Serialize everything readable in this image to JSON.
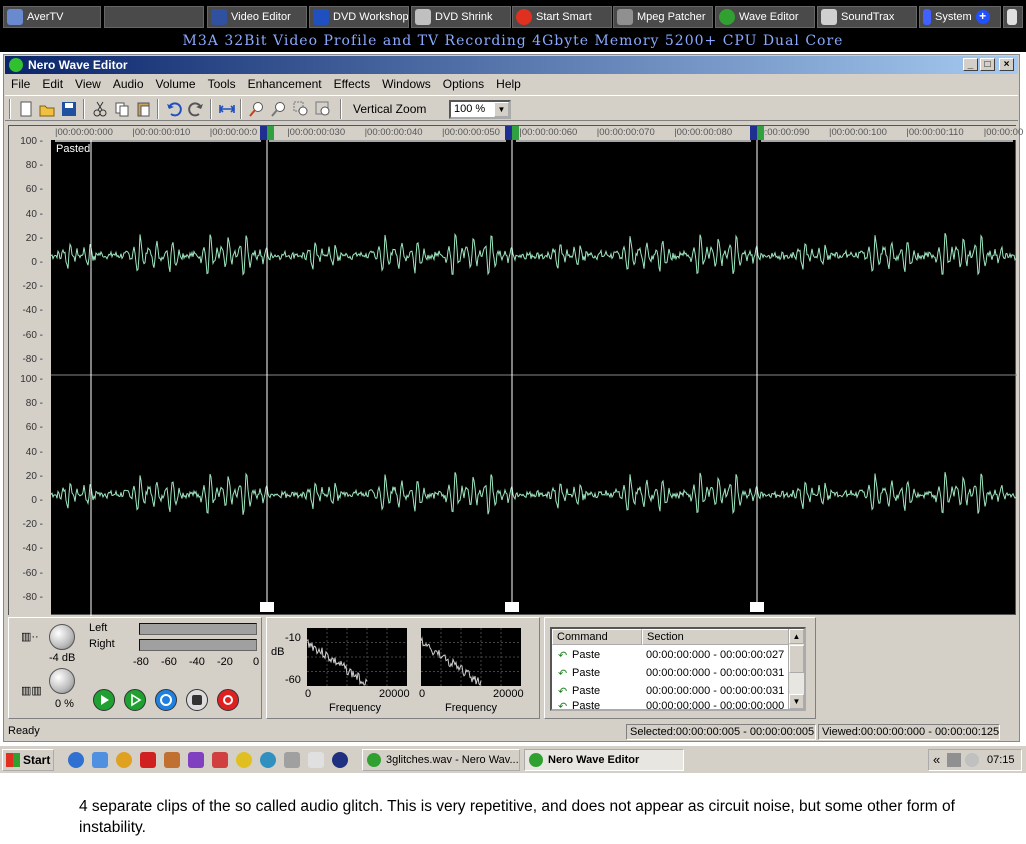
{
  "launcher": {
    "buttons": [
      {
        "label": "AverTV",
        "icon": "tv-icon",
        "color": "#6a8ad0"
      },
      {
        "label": "",
        "icon": "blank-icon",
        "color": "#4a4a4a"
      },
      {
        "label": "Video Editor",
        "icon": "video-editor-icon",
        "color": "#3050a0"
      },
      {
        "label": "DVD Workshop",
        "icon": "dvd-workshop-icon",
        "color": "#2050c0"
      },
      {
        "label": "DVD Shrink",
        "icon": "dvd-shrink-icon",
        "color": "#c0c0c0"
      },
      {
        "label": "Start Smart",
        "icon": "start-smart-icon",
        "color": "#e03020"
      },
      {
        "label": "Mpeg Patcher",
        "icon": "mpeg-patcher-icon",
        "color": "#909090"
      },
      {
        "label": "Wave Editor",
        "icon": "wave-editor-icon",
        "color": "#30a030"
      },
      {
        "label": "SoundTrax",
        "icon": "soundtrax-icon",
        "color": "#d0d0d0"
      },
      {
        "label": "System",
        "icon": "system-icon",
        "color": "#4060ff"
      }
    ],
    "banner": "M3A 32Bit Video Profile and TV Recording 4Gbyte Memory 5200+ CPU Dual Core"
  },
  "window": {
    "title": "Nero Wave Editor",
    "controls": [
      "_",
      "□",
      "×"
    ],
    "menu": [
      "File",
      "Edit",
      "View",
      "Audio",
      "Volume",
      "Tools",
      "Enhancement",
      "Effects",
      "Windows",
      "Options",
      "Help"
    ],
    "toolbar": {
      "vertical_zoom_label": "Vertical Zoom",
      "vertical_zoom_value": "100 %"
    }
  },
  "wave": {
    "pasted_label": "Pasted",
    "ruler_ticks": [
      "00:00:00:000",
      "00:00:00:010",
      "00:00:00:0",
      "00:00:00:030",
      "00:00:00:040",
      "00:00:00:050",
      "00:00:00:060",
      "00:00:00:070",
      "00:00:00:080",
      "00:00:00:090",
      "00:00:00:100",
      "00:00:00:110",
      "00:00:00"
    ],
    "axis_labels_top": [
      "100",
      "80",
      "60",
      "40",
      "20",
      "0",
      "-20",
      "-40",
      "-60",
      "-80"
    ],
    "axis_labels_bottom": [
      "100",
      "80",
      "60",
      "40",
      "20",
      "0",
      "-20",
      "-40",
      "-60",
      "-80"
    ],
    "wave_color": "#9fe8c0"
  },
  "panels": {
    "volume_db": "-4 dB",
    "balance_pct": "0 %",
    "left_label": "Left",
    "right_label": "Right",
    "meter_ticks": [
      "-80",
      "-60",
      "-40",
      "-20",
      "0"
    ],
    "spectrum": {
      "db_label": "dB",
      "y_ticks": [
        "-10",
        "-60"
      ],
      "x_ticks_a": [
        "0",
        "20000"
      ],
      "x_ticks_b": [
        "0",
        "20000"
      ],
      "freq_label": "Frequency"
    },
    "history": {
      "col_command": "Command",
      "col_section": "Section",
      "rows": [
        {
          "command": "Paste",
          "section": "00:00:00:000 - 00:00:00:027"
        },
        {
          "command": "Paste",
          "section": "00:00:00:000 - 00:00:00:031"
        },
        {
          "command": "Paste",
          "section": "00:00:00:000 - 00:00:00:031"
        },
        {
          "command": "Paste",
          "section": "00:00:00:000 - 00:00:00:000"
        }
      ]
    }
  },
  "status": {
    "state": "Ready",
    "selected": "Selected:00:00:00:005 - 00:00:00:005",
    "viewed": "Viewed:00:00:00:000 - 00:00:00:125"
  },
  "taskbar": {
    "start_label": "Start",
    "tasks": [
      "3glitches.wav - Nero Wav...",
      "Nero Wave Editor"
    ],
    "tray_chevron": "«",
    "clock": "07:15"
  },
  "caption": "4 separate clips of the so called audio glitch. This is very repetitive, and does not appear as circuit noise, but some other form of instability."
}
